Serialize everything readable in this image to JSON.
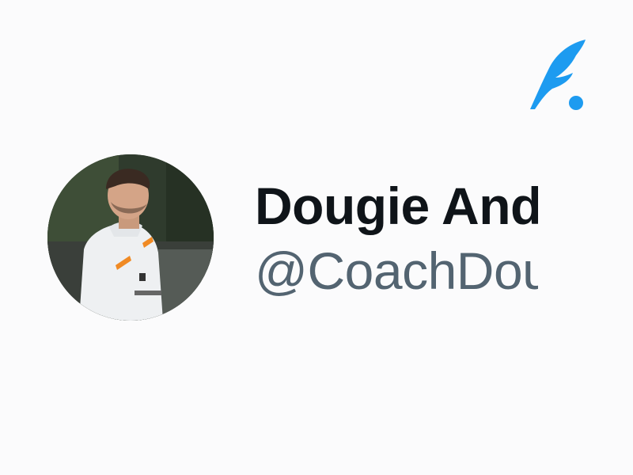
{
  "profile": {
    "display_name": "Dougie Anderson",
    "handle": "@CoachDougie",
    "avatar_description_icon": "profile-photo"
  },
  "brand": {
    "logo_icon": "quill-feather-logo-icon",
    "accent_color": "#1d9bf0"
  },
  "colors": {
    "name": "#0f1419",
    "handle": "#536471",
    "background": "#fbfbfc"
  }
}
